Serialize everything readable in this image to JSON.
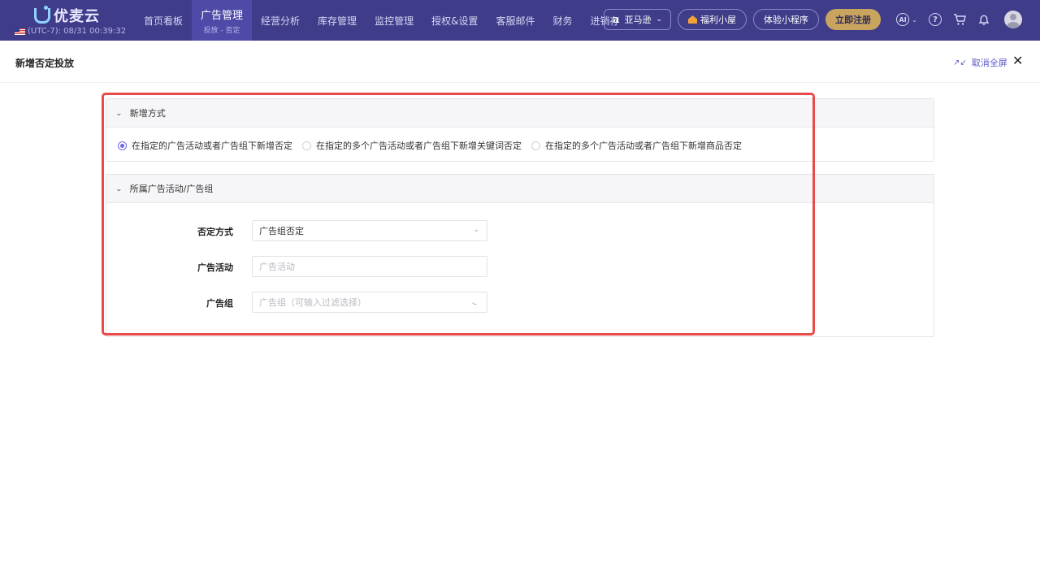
{
  "topbar": {
    "logo_text": "优麦云",
    "timezone": "(UTC-7): 08/31 00:39:32",
    "nav": [
      {
        "label": "首页看板",
        "sub": ""
      },
      {
        "label": "广告管理",
        "sub": "投放 - 否定"
      },
      {
        "label": "经营分析",
        "sub": ""
      },
      {
        "label": "库存管理",
        "sub": ""
      },
      {
        "label": "监控管理",
        "sub": ""
      },
      {
        "label": "授权&设置",
        "sub": ""
      },
      {
        "label": "客服邮件",
        "sub": ""
      },
      {
        "label": "财务",
        "sub": ""
      },
      {
        "label": "进销存",
        "sub": ""
      }
    ],
    "marketplace": {
      "icon_letter": "a",
      "label": "亚马逊"
    },
    "welfare_label": "福利小屋",
    "miniapp_label": "体验小程序",
    "register_label": "立即注册",
    "colors": {
      "bar": "#3f3d8a",
      "accent": "#6c6ae0",
      "register": "#c9a45e"
    }
  },
  "page": {
    "title": "新增否定投放",
    "exit_fullscreen": "取消全屏"
  },
  "section_method": {
    "title": "新增方式",
    "options": [
      {
        "label": "在指定的广告活动或者广告组下新增否定",
        "checked": true
      },
      {
        "label": "在指定的多个广告活动或者广告组下新增关键词否定",
        "checked": false
      },
      {
        "label": "在指定的多个广告活动或者广告组下新增商品否定",
        "checked": false
      }
    ]
  },
  "section_scope": {
    "title": "所属广告活动/广告组",
    "fields": {
      "negate_mode": {
        "label": "否定方式",
        "value": "广告组否定"
      },
      "campaign": {
        "label": "广告活动",
        "placeholder": "广告活动"
      },
      "ad_group": {
        "label": "广告组",
        "placeholder": "广告组（可输入过滤选择）"
      }
    }
  },
  "annotation_color": "#e94b4b"
}
